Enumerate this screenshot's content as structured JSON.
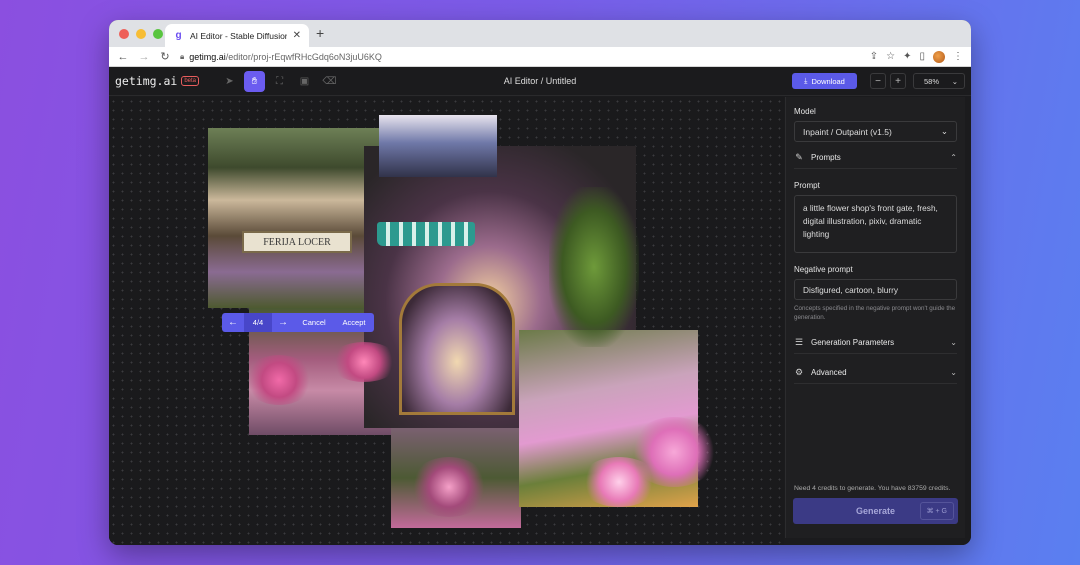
{
  "browser": {
    "tab_title": "AI Editor - Stable Diffusion Outpainting",
    "url_host": "getimg.ai",
    "url_path": "/editor/proj-rEqwfRHcGdq6oN3juU6KQ"
  },
  "app": {
    "logo": "getimg.ai",
    "beta": "beta",
    "title": "AI Editor / Untitled",
    "download_label": "Download",
    "zoom_out": "−",
    "zoom_in": "+",
    "zoom_level": "58%"
  },
  "canvas": {
    "sign_text": "FERIJA LOCER",
    "stepper": {
      "count": "4/4",
      "cancel": "Cancel",
      "accept": "Accept"
    }
  },
  "panel": {
    "model_label": "Model",
    "model_value": "Inpaint / Outpaint (v1.5)",
    "prompts_section": "Prompts",
    "prompt_label": "Prompt",
    "prompt_value": "a little flower shop's front gate, fresh, digital illustration, pixiv, dramatic lighting",
    "negative_label": "Negative prompt",
    "negative_value": "Disfigured, cartoon, blurry",
    "negative_hint": "Concepts specified in the negative prompt won't guide the generation.",
    "gen_params_section": "Generation Parameters",
    "advanced_section": "Advanced",
    "credits_text": "Need 4 credits to generate. You have 83759 credits.",
    "generate_label": "Generate",
    "shortcut": "⌘ + G"
  },
  "colors": {
    "accent": "#5b5ae8",
    "generate_bg": "#3b3a85"
  }
}
